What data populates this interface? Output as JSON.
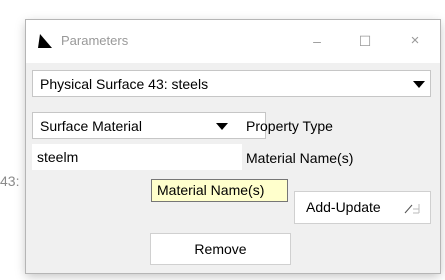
{
  "background_fragment": "43:",
  "window": {
    "title": "Parameters",
    "controls": {
      "minimize": "–",
      "maximize": "☐",
      "close": "×"
    }
  },
  "surface_select": {
    "value": "Physical Surface 43: steels"
  },
  "property": {
    "select_value": "Surface Material",
    "label": "Property Type"
  },
  "material_name": {
    "value": "steelm",
    "label": "Material Name(s)",
    "tooltip": "Material Name(s)"
  },
  "buttons": {
    "add_update": "Add-Update",
    "remove": "Remove"
  }
}
